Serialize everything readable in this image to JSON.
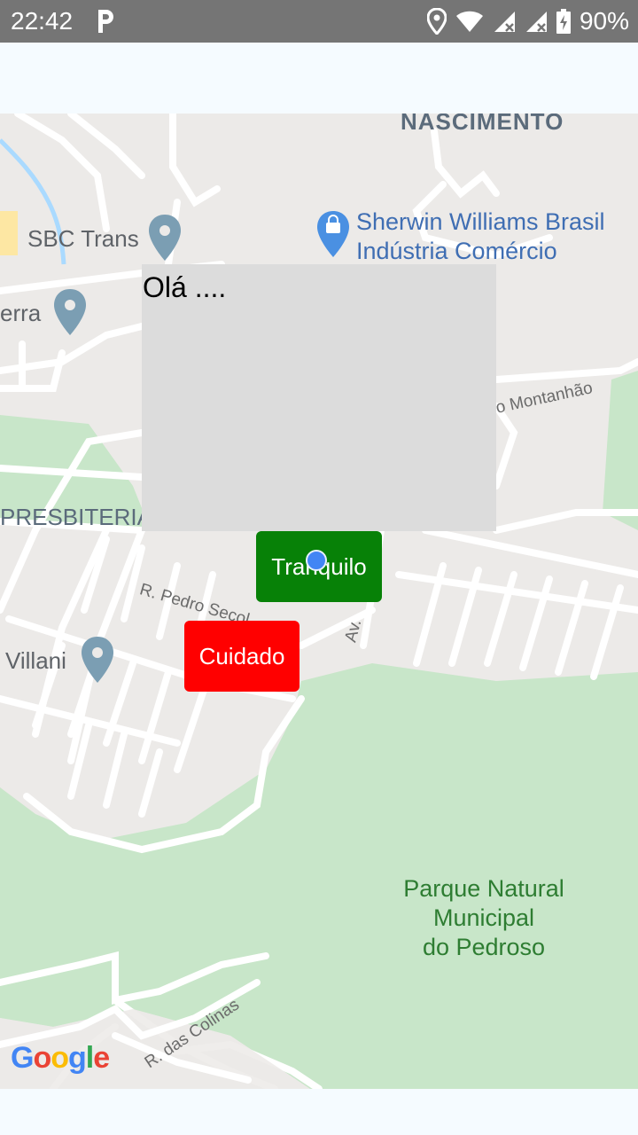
{
  "status_bar": {
    "time": "22:42",
    "battery": "90%",
    "icons": [
      "parking-icon",
      "location-icon",
      "wifi-icon",
      "signal-icon",
      "signal-icon-2",
      "battery-icon"
    ]
  },
  "map": {
    "labels": {
      "nascimento": "NASCIMENTO",
      "sbc_trans": "SBC Trans",
      "sherwin_line1": "Sherwin Williams Brasil",
      "sherwin_line2": "Indústria Comércio",
      "serra": "erra",
      "montanhao": "o Montanhão",
      "presbiteriana": "PRESBITERIAI",
      "pedro_secol": "R. Pedro Secol",
      "av_label": "Av.",
      "villani": "Villani",
      "park_line1": "Parque Natural",
      "park_line2": "Municipal",
      "park_line3": "do Pedroso",
      "das_colinas": "R. das Colinas"
    },
    "colors": {
      "park": "#c8e6c9",
      "road": "#ffffff",
      "land": "#eceae8",
      "water": "#aadaff"
    }
  },
  "popup": {
    "text": "Olá ...."
  },
  "buttons": {
    "tranquilo": "Tranquilo",
    "cuidado": "Cuidado"
  },
  "colors": {
    "tranquilo": "#078107",
    "cuidado": "#ff0000",
    "location_dot": "#4285f4"
  },
  "google_logo": {
    "letters": [
      "G",
      "o",
      "o",
      "g",
      "l",
      "e"
    ]
  }
}
